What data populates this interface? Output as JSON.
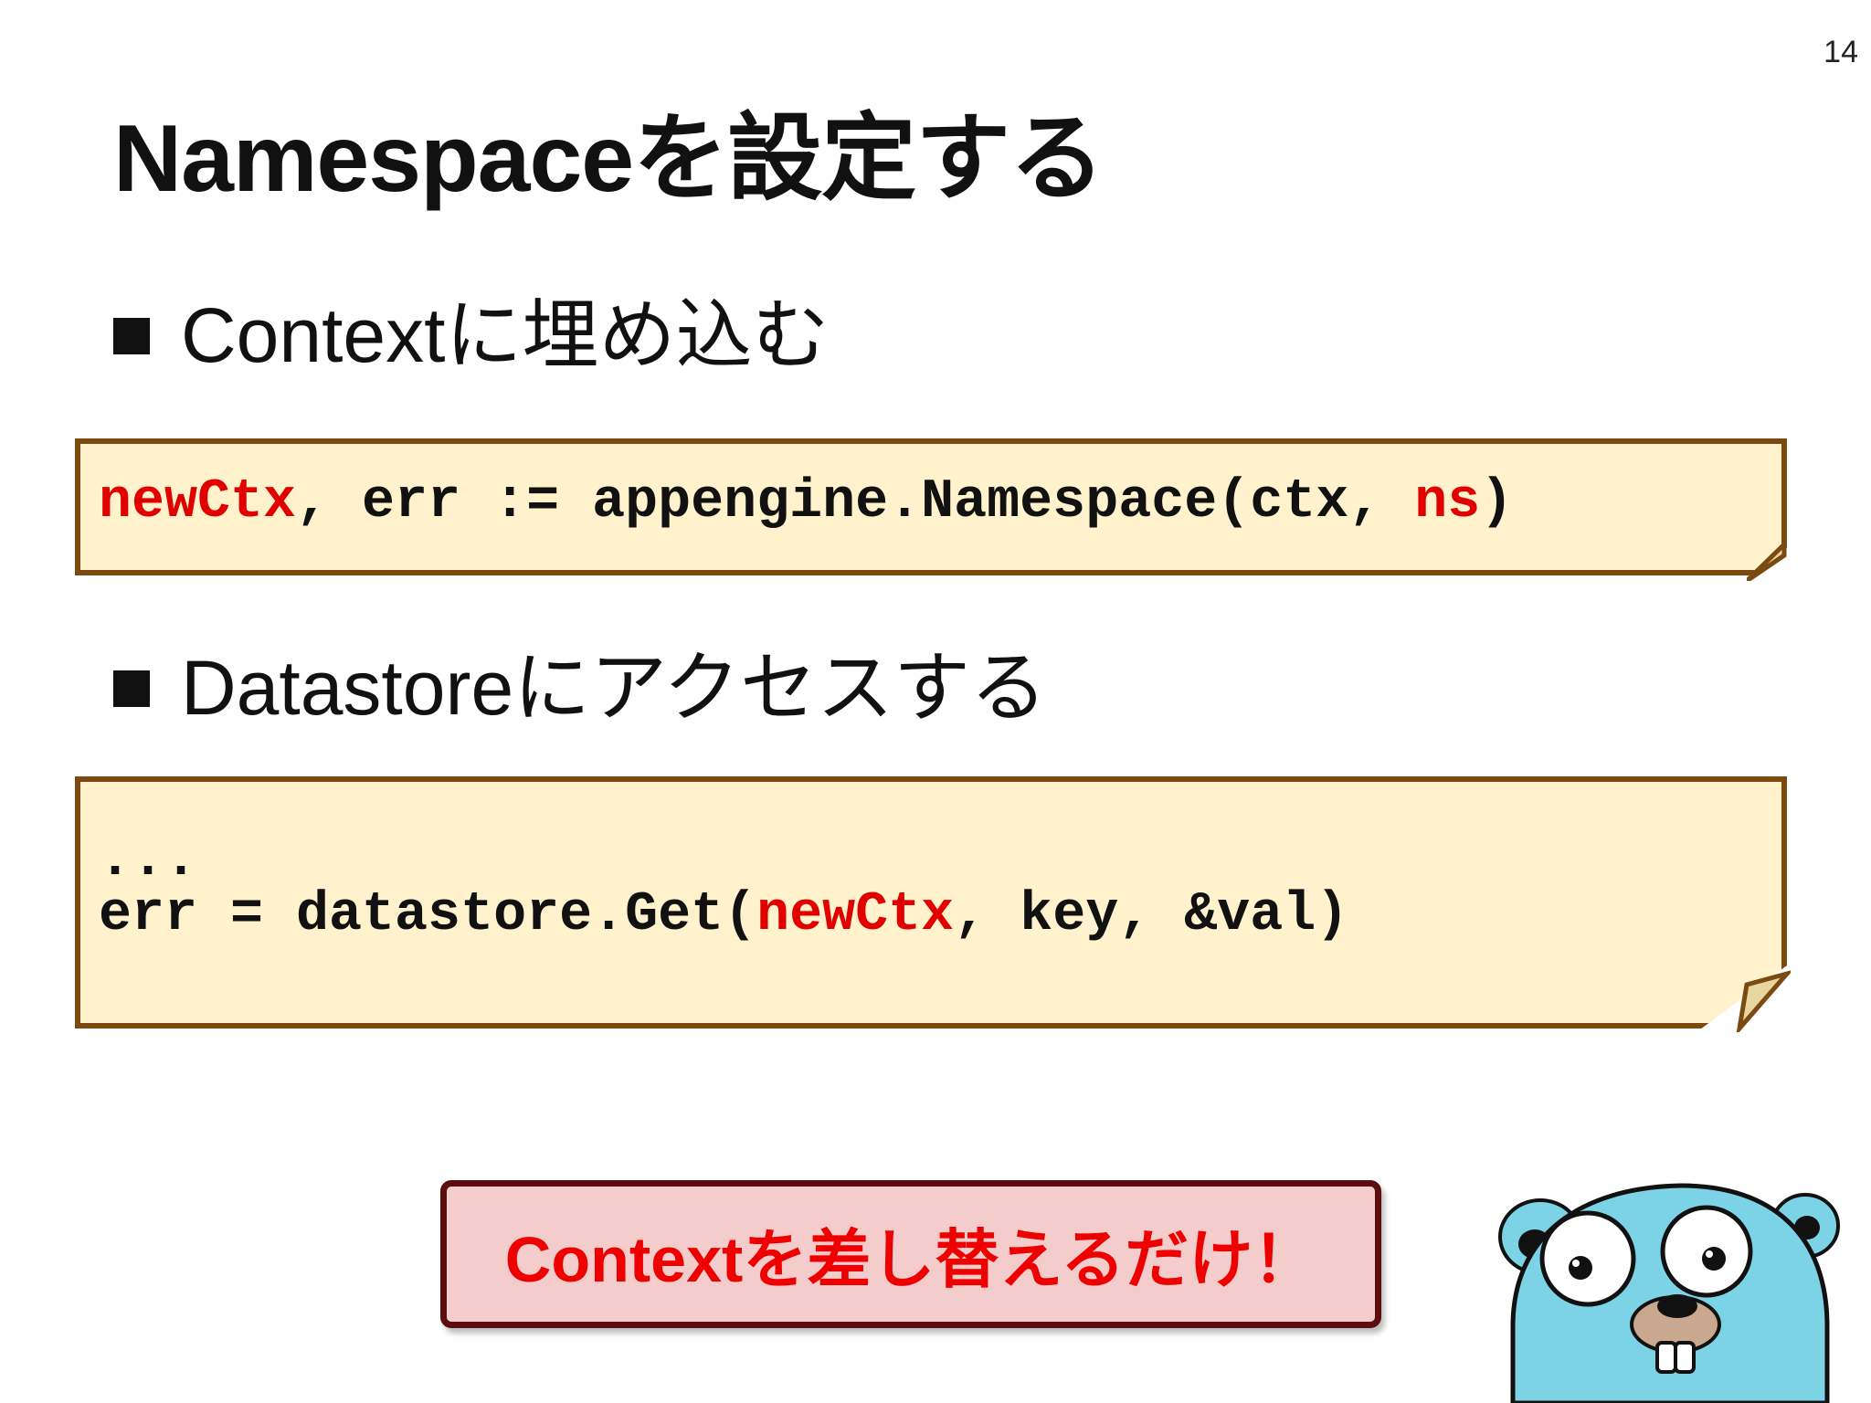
{
  "page_number": "14",
  "title": "Namespaceを設定する",
  "bullets": [
    "Contextに埋め込む",
    "Datastoreにアクセスする"
  ],
  "code_block_1": {
    "line": {
      "t1": "newCtx",
      "t2": ", err := appengine.Namespace(ctx, ",
      "t3": "ns",
      "t4": ")"
    }
  },
  "code_block_2": {
    "line_a": "...",
    "line_b": {
      "t1": "err = datastore.Get(",
      "t2": "newCtx",
      "t3": ", key, &val)"
    }
  },
  "callout": "Contextを差し替えるだけ！",
  "colors": {
    "highlight": "#e00000",
    "code_bg": "#fff2cc",
    "code_border": "#7b4a10",
    "callout_bg": "#f4cccc",
    "callout_border": "#5c0e0e",
    "gopher_body": "#7dd3e6"
  },
  "icons": {
    "mascot": "go-gopher-icon",
    "bullet": "square-bullet-icon"
  }
}
